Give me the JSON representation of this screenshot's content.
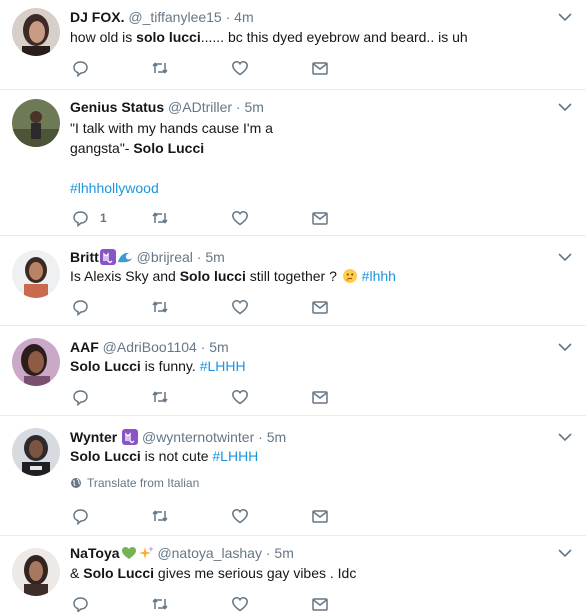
{
  "colors": {
    "text": "#14171a",
    "secondary": "#657786",
    "hashtag": "#1b95e0",
    "divider": "#e6ecf0"
  },
  "tweets": [
    {
      "name": "DJ FOX.",
      "handle": "@_tiffanylee15",
      "dot": "·",
      "time": "4m",
      "body": [
        {
          "pre": "how old is ",
          "bold": "solo lucci",
          "post": "...... bc this dyed eyebrow and beard.. is uh"
        }
      ],
      "icons": [
        "reply-icon",
        "retweet-icon",
        "like-icon",
        "message-icon"
      ]
    },
    {
      "name": "Genius Status",
      "handle": "@ADtriller",
      "dot": "·",
      "time": "5m",
      "body": [
        {
          "text": "\"I talk with my hands cause I'm a"
        },
        {
          "pre": "gangsta\"- ",
          "bold": "Solo Lucci"
        },
        {
          "hashtag": "#lhhhollywood"
        }
      ],
      "reply_count": "1"
    },
    {
      "name": "Britt",
      "emoji": [
        "scorpio-icon",
        "wave-icon"
      ],
      "handle": "@brijreal",
      "dot": "·",
      "time": "5m",
      "body": [
        {
          "pre": "Is Alexis Sky and ",
          "bold": "Solo lucci",
          "post": " still together ? ",
          "emoji": "thinking-face-icon",
          "hashtag": " #lhhh"
        }
      ]
    },
    {
      "name": "AAF",
      "handle": "@AdriBoo1104",
      "dot": "·",
      "time": "5m",
      "body": [
        {
          "bold": "Solo Lucci",
          "post": " is funny. ",
          "hashtag": "#LHHH"
        }
      ]
    },
    {
      "name": "Wynter",
      "emoji": [
        "scorpio-icon"
      ],
      "handle": "@wynternotwinter",
      "dot": "·",
      "time": "5m",
      "body": [
        {
          "bold": "Solo Lucci",
          "post": " is not cute ",
          "hashtag": "#LHHH"
        }
      ],
      "translate": "Translate from Italian"
    },
    {
      "name": "NaToya",
      "emoji": [
        "green-heart-icon",
        "sparkles-icon"
      ],
      "handle": "@natoya_lashay",
      "dot": "·",
      "time": "5m",
      "body": [
        {
          "pre": "& ",
          "bold": "Solo Lucci",
          "post": " gives me serious gay vibes . Idc"
        }
      ]
    }
  ]
}
